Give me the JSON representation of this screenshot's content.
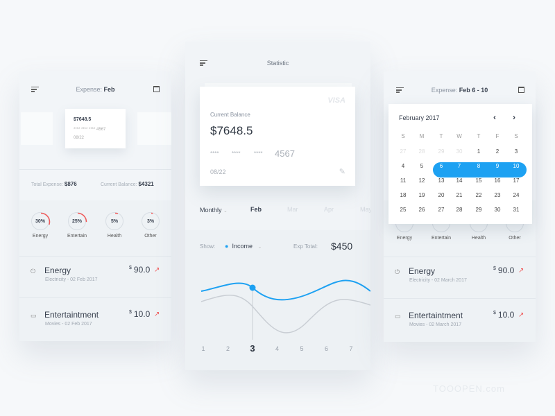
{
  "left": {
    "header_label": "Expense:",
    "header_value": "Feb",
    "card": {
      "balance": "$7648.5",
      "masked": "**** **** ****",
      "last4": "4567",
      "expiry": "08/22"
    },
    "total_expense_label": "Total Expense:",
    "total_expense": "$876",
    "current_balance_label": "Current Balance:",
    "current_balance": "$4321",
    "categories": [
      {
        "pct": "30%",
        "label": "Energy",
        "value": 30
      },
      {
        "pct": "25%",
        "label": "Entertain",
        "value": 25
      },
      {
        "pct": "5%",
        "label": "Health",
        "value": 5
      },
      {
        "pct": "3%",
        "label": "Other",
        "value": 3
      }
    ],
    "items": [
      {
        "title": "Energy",
        "sub": "Electricity - 02 Feb 2017",
        "currency": "$",
        "amount": "90.0"
      },
      {
        "title": "Entertaintment",
        "sub": "Movies - 02 Feb 2017",
        "currency": "$",
        "amount": "10.0"
      }
    ]
  },
  "center": {
    "title": "Statistic",
    "card": {
      "brand": "VISA",
      "label": "Current Balance",
      "balance": "$7648.5",
      "masked": [
        "****",
        "****",
        "****"
      ],
      "last4": "4567",
      "expiry": "08/22"
    },
    "period": "Monthly",
    "months": [
      "Feb",
      "Mar",
      "Apr",
      "May"
    ],
    "show_label": "Show:",
    "show_value": "Income",
    "exp_total_label": "Exp Total:",
    "exp_total": "$450",
    "x_labels": [
      "1",
      "2",
      "3",
      "4",
      "5",
      "6",
      "7"
    ],
    "selected_x": "3"
  },
  "right": {
    "header_label": "Expense:",
    "header_value": "Feb 6 - 10",
    "calendar": {
      "month": "February 2017",
      "weekdays": [
        "S",
        "M",
        "T",
        "W",
        "T",
        "F",
        "S"
      ],
      "days": [
        [
          "27",
          "28",
          "29",
          "30",
          "1",
          "2",
          "3"
        ],
        [
          "4",
          "5",
          "6",
          "7",
          "8",
          "9",
          "10"
        ],
        [
          "11",
          "12",
          "13",
          "14",
          "15",
          "16",
          "17"
        ],
        [
          "18",
          "19",
          "20",
          "21",
          "22",
          "23",
          "24"
        ],
        [
          "25",
          "26",
          "27",
          "28",
          "29",
          "30",
          "31"
        ]
      ]
    },
    "categories": [
      "Energy",
      "Entertain",
      "Health",
      "Other"
    ],
    "items": [
      {
        "title": "Energy",
        "sub": "Electricity - 02 March 2017",
        "currency": "$",
        "amount": "90.0"
      },
      {
        "title": "Entertaintment",
        "sub": "Movies - 02 March 2017",
        "currency": "$",
        "amount": "10.0"
      }
    ]
  },
  "colors": {
    "accent": "#1da1f2",
    "danger": "#f05a5a"
  },
  "watermark": "TOOOPEN.com"
}
